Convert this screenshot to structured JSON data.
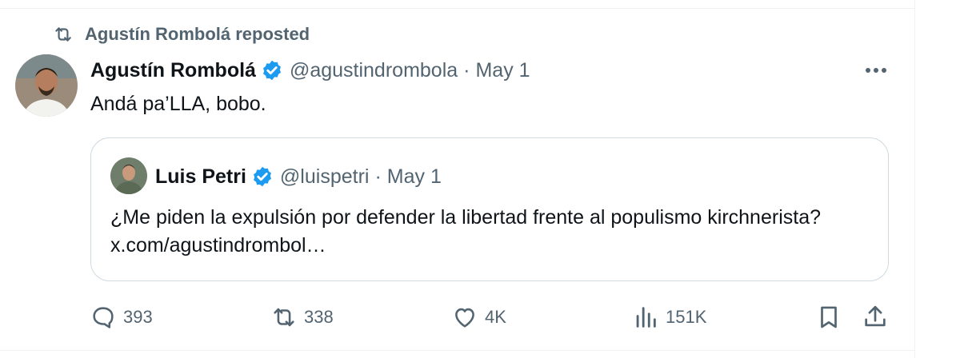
{
  "repost": {
    "label": "Agustín Rombolá reposted",
    "icon": "repost-icon"
  },
  "tweet": {
    "author_name": "Agustín Rombolá",
    "author_handle": "@agustindrombola",
    "separator": "·",
    "date": "May 1",
    "text": "Andá pa’LLA, bobo."
  },
  "quote": {
    "author_name": "Luis Petri",
    "author_handle": "@luispetri",
    "separator": "·",
    "date": "May 1",
    "text": "¿Me piden la expulsión por defender la libertad frente al populismo kirchnerista? x.com/agustindrombol…"
  },
  "actions": {
    "replies": "393",
    "reposts": "338",
    "likes": "4K",
    "views": "151K"
  },
  "colors": {
    "verified": "#1d9bf0",
    "muted": "#536471",
    "text": "#0f1419",
    "border": "#cfd9de"
  }
}
